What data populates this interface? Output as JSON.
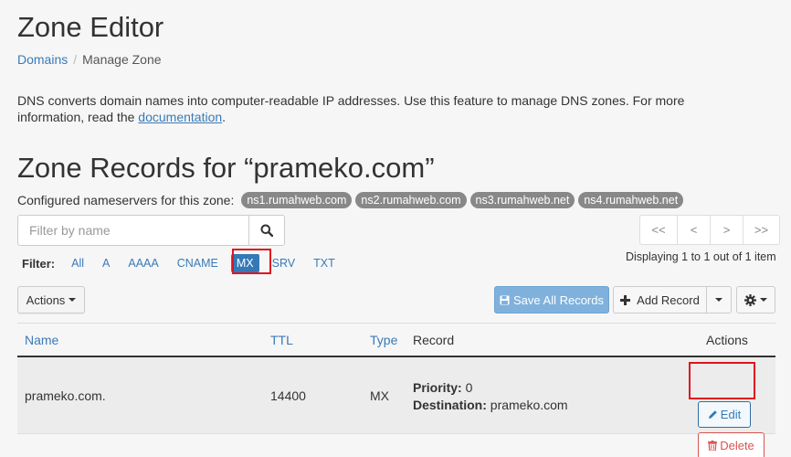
{
  "header": {
    "title": "Zone Editor",
    "breadcrumb": {
      "root": "Domains",
      "separator": "/",
      "current": "Manage Zone"
    }
  },
  "description": {
    "text": "DNS converts domain names into computer-readable IP addresses. Use this feature to manage DNS zones. For more information, read the ",
    "link": "documentation",
    "end": "."
  },
  "records": {
    "title": "Zone Records for “prameko.com”",
    "nameservers_label": "Configured nameservers for this zone:",
    "nameservers": [
      "ns1.rumahweb.com",
      "ns2.rumahweb.com",
      "ns3.rumahweb.net",
      "ns4.rumahweb.net"
    ]
  },
  "search": {
    "placeholder": "Filter by name",
    "icon": "search-icon"
  },
  "pagination": {
    "first": "<<",
    "prev": "<",
    "next": ">",
    "last": ">>",
    "info": "Displaying 1 to 1 out of 1 item"
  },
  "filter": {
    "label": "Filter:",
    "tabs": [
      "All",
      "A",
      "AAAA",
      "CNAME",
      "MX",
      "SRV",
      "TXT"
    ],
    "active": "MX"
  },
  "toolbar": {
    "actions_label": "Actions",
    "save_all_label": "Save All Records",
    "add_record_label": "Add Record",
    "settings_icon": "gear-icon"
  },
  "table": {
    "columns": {
      "name": "Name",
      "ttl": "TTL",
      "type": "Type",
      "record": "Record",
      "actions": "Actions"
    },
    "rows": [
      {
        "name": "prameko.com.",
        "ttl": "14400",
        "type": "MX",
        "priority_label": "Priority:",
        "priority": "0",
        "destination_label": "Destination:",
        "destination": "prameko.com",
        "edit_label": "Edit",
        "delete_label": "Delete"
      }
    ]
  },
  "colors": {
    "accent": "#3379b7",
    "highlight": "#e0141e",
    "danger": "#d9534f"
  }
}
